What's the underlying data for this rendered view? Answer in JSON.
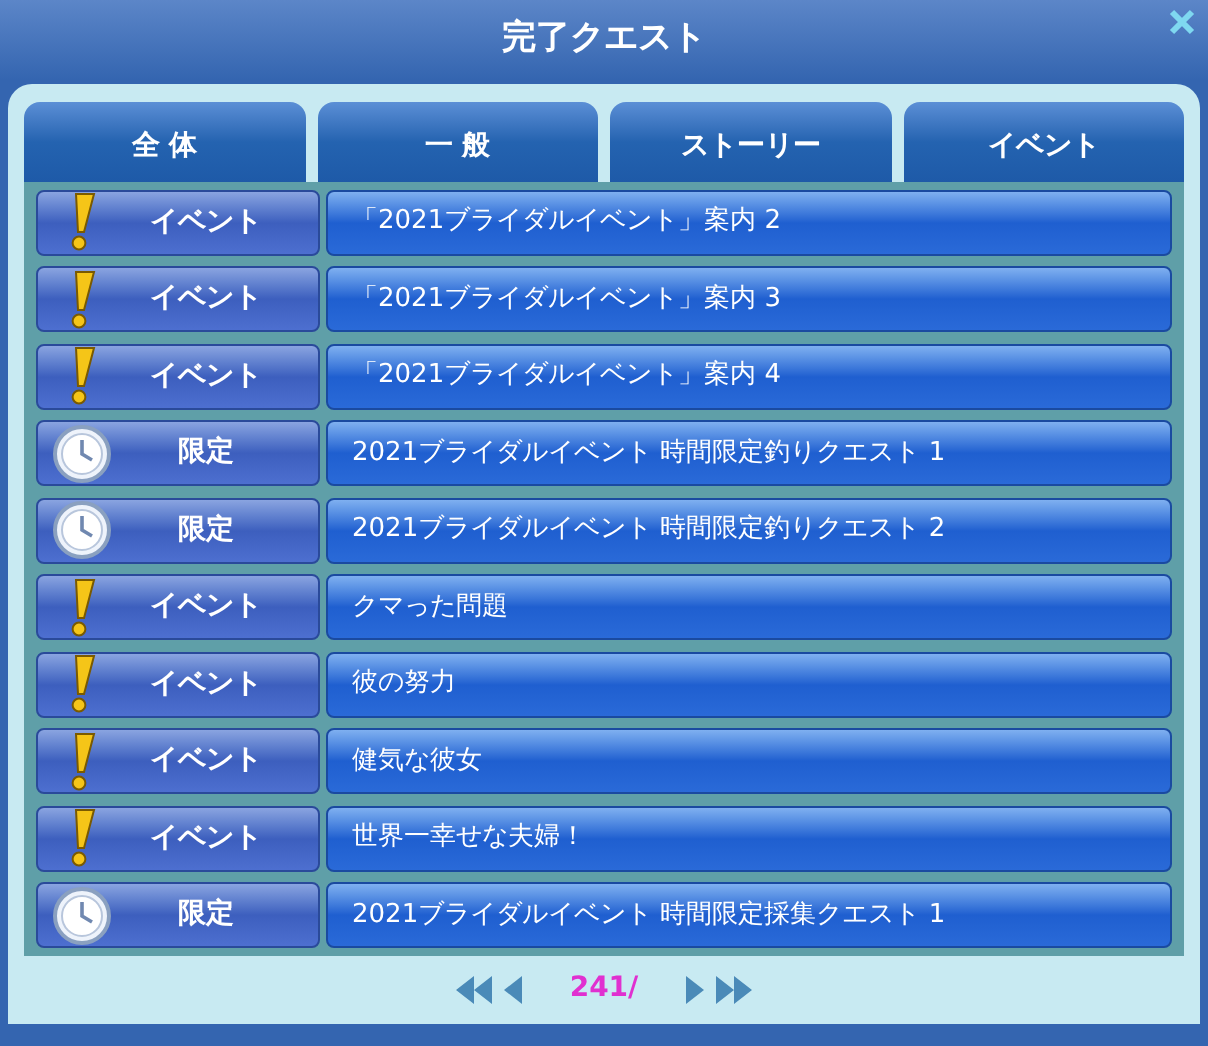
{
  "window": {
    "title": "完了クエスト"
  },
  "tabs": [
    {
      "label": "全 体",
      "selected": false
    },
    {
      "label": "一 般",
      "selected": false
    },
    {
      "label": "ストーリー",
      "selected": false
    },
    {
      "label": "イベント",
      "selected": false
    }
  ],
  "quests": [
    {
      "kind": "event",
      "category": "イベント",
      "title": "「2021ブライダルイベント」案内 2"
    },
    {
      "kind": "event",
      "category": "イベント",
      "title": "「2021ブライダルイベント」案内 3"
    },
    {
      "kind": "event",
      "category": "イベント",
      "title": "「2021ブライダルイベント」案内 4"
    },
    {
      "kind": "limited",
      "category": "限定",
      "title": "2021ブライダルイベント 時間限定釣りクエスト 1"
    },
    {
      "kind": "limited",
      "category": "限定",
      "title": "2021ブライダルイベント 時間限定釣りクエスト 2"
    },
    {
      "kind": "event",
      "category": "イベント",
      "title": "クマった問題"
    },
    {
      "kind": "event",
      "category": "イベント",
      "title": "彼の努力"
    },
    {
      "kind": "event",
      "category": "イベント",
      "title": "健気な彼女"
    },
    {
      "kind": "event",
      "category": "イベント",
      "title": "世界一幸せな夫婦！"
    },
    {
      "kind": "limited",
      "category": "限定",
      "title": "2021ブライダルイベント 時間限定採集クエスト 1"
    }
  ],
  "pagination": {
    "page": "241/"
  }
}
